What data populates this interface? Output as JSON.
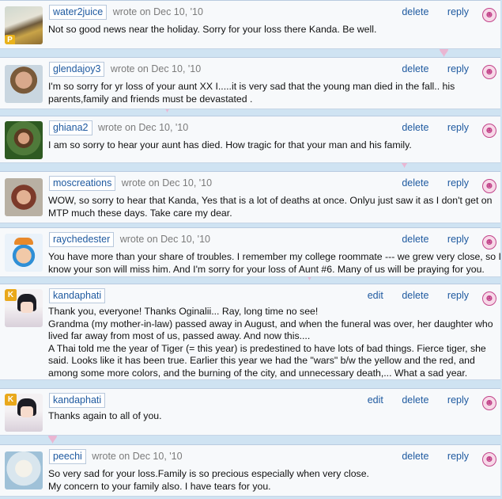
{
  "actions": {
    "edit": "edit",
    "delete": "delete",
    "reply": "reply"
  },
  "comments": [
    {
      "user": "water2juice",
      "wrote": "wrote on Dec 10, '10",
      "avatar": "duck-avatar",
      "badge": "P",
      "lines": [
        "Not so good news near the holiday. Sorry for your loss there Kanda. Be well."
      ]
    },
    {
      "user": "glendajoy3",
      "wrote": "wrote on Dec 10, '10",
      "avatar": "woman-photo-avatar",
      "lines": [
        "I'm so sorry for yr loss of your aunt XX I.....it is very sad that the young man died in the fall.. his",
        "parents,family and friends must be devastated ."
      ]
    },
    {
      "user": "ghiana2",
      "wrote": "wrote on Dec 10, '10",
      "avatar": "garden-photo-avatar",
      "lines": [
        "I am so sorry to hear your aunt has died. How tragic for that your man and his family."
      ]
    },
    {
      "user": "moscreations",
      "wrote": "wrote on Dec 10, '10",
      "avatar": "grandma-photo-avatar",
      "lines": [
        "WOW, so sorry to hear that Kanda, Yes that is a lot of deaths at once. Onlyu just saw it as I don't get on",
        "MTP much these days. Take care my dear."
      ]
    },
    {
      "user": "raychedester",
      "wrote": "wrote on Dec 10, '10",
      "avatar": "cartoon-man-avatar",
      "lines": [
        "You have more than your share of troubles. I remember my college roommate --- we grew very close, so I",
        "know your son will miss him. And I'm sorry for your loss of Aunt #6. Many of us will be praying for you."
      ]
    },
    {
      "user": "kandaphati",
      "wrote": "",
      "avatar": "anime-girl-avatar",
      "badge": "K",
      "editable": true,
      "lines": [
        "Thank you, everyone! Thanks Oginalii... Ray, long time no see!",
        "Grandma (my mother-in-law) passed away in August, and when the funeral was over, her daughter who",
        "lived far away from most of us, passed away. And now this....",
        "A Thai told me the year of Tiger (= this year) is predestined to have lots of bad things. Fierce tiger, she",
        "said. Looks like it has been true. Earlier this year we had the \"wars\" b/w the yellow and the red, and",
        "among some more colors, and the burning of the city, and unnecessary death,... What a sad year."
      ]
    },
    {
      "user": "kandaphati",
      "wrote": "",
      "avatar": "anime-girl-avatar",
      "badge": "K",
      "editable": true,
      "lines": [
        "Thanks again to all of you."
      ]
    },
    {
      "user": "peechi",
      "wrote": "wrote on Dec 10, '10",
      "avatar": "polar-bear-avatar",
      "lines": [
        "So very sad for your loss.Family is so precious especially when very close.",
        "My concern to your family also. I have tears for you."
      ]
    }
  ]
}
